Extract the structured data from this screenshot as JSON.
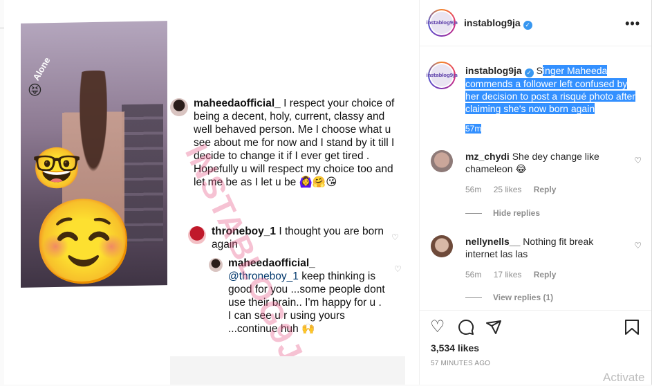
{
  "media": {
    "sticker_text": "Alone",
    "watermark": "INSTABLOG9JA",
    "comment_main": {
      "username": "maheedaofficial_",
      "text": "I respect your choice of being a decent, holy, current, classy and well behaved person. Me I choose what u see about me for now and I stand by it till I decide to change it if I ever get tired . Hopefully u will respect my choice too and let me be as I let u be 🙆‍♀️🤗😘"
    },
    "reply_1": {
      "username": "throneboy_1",
      "text": "I thought you are born again"
    },
    "reply_2": {
      "username": "maheedaofficial_",
      "mention": "@throneboy_1",
      "text": "keep thinking is good for you ...some people dont use their brain.. I'm happy for u . I can see u r using yours ...continue huh 🙌"
    }
  },
  "header": {
    "username": "instablog9ja",
    "logo_text": "instablog9ja",
    "more_icon": "more-horizontal-icon"
  },
  "caption": {
    "username": "instablog9ja",
    "pre": "S",
    "text": "inger Maheeda commends a follower left confused by her decision to post a risqué photo after claiming she's now born again",
    "time": "57m"
  },
  "comments": [
    {
      "username": "mz_chydi",
      "text": "She dey change like chameleon 😂",
      "time": "56m",
      "likes": "25 likes",
      "reply": "Reply",
      "thread": "Hide replies"
    },
    {
      "username": "nellynells__",
      "text": "Nothing fit break internet las las",
      "time": "56m",
      "likes": "17 likes",
      "reply": "Reply",
      "thread": "View replies (1)"
    }
  ],
  "footer": {
    "likes": "3,534 likes",
    "posted": "57 MINUTES AGO"
  },
  "overlay": {
    "activate": "Activate"
  },
  "colors": {
    "accent": "#3897f0",
    "selection": "#3390ff"
  }
}
